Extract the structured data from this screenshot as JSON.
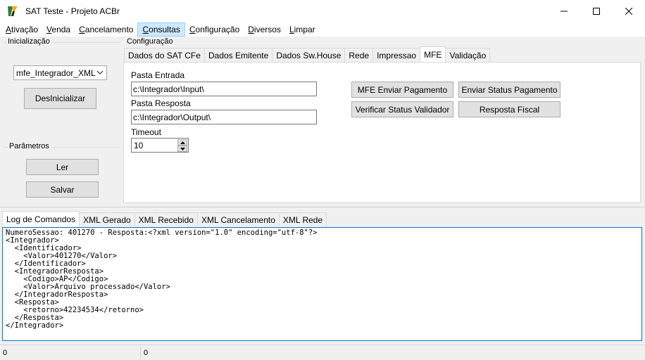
{
  "window": {
    "title": "SAT Teste - Projeto ACBr",
    "minimize": "—",
    "maximize": "☐",
    "close": "✕"
  },
  "menu": [
    {
      "underline": "A",
      "rest": "tivação"
    },
    {
      "underline": "V",
      "rest": "enda"
    },
    {
      "underline": "C",
      "rest": "ancelamento"
    },
    {
      "underline": "C",
      "rest": "onsultas"
    },
    {
      "underline": "C",
      "rest": "onfiguração"
    },
    {
      "underline": "D",
      "rest": "iversos"
    },
    {
      "underline": "L",
      "rest": "impar"
    }
  ],
  "inicializacao": {
    "title": "Inicialização",
    "combo_value": "mfe_Integrador_XML",
    "button": "DesInicializar"
  },
  "parametros": {
    "title": "Parâmetros",
    "ler": "Ler",
    "salvar": "Salvar"
  },
  "configuracao": {
    "title": "Configuração",
    "tabs": [
      "Dados do SAT CFe",
      "Dados Emitente",
      "Dados Sw.House",
      "Rede",
      "Impressao",
      "MFE",
      "Validação"
    ],
    "active_tab": "MFE",
    "pasta_entrada_label": "Pasta Entrada",
    "pasta_entrada_value": "c:\\Integrador\\Input\\",
    "pasta_resposta_label": "Pasta Resposta",
    "pasta_resposta_value": "c:\\Integrador\\Output\\",
    "timeout_label": "Timeout",
    "timeout_value": "10",
    "btn_enviar_pagamento": "MFE Enviar Pagamento",
    "btn_enviar_status": "Enviar Status Pagamento",
    "btn_verificar_status": "Verificar Status Validador",
    "btn_resposta_fiscal": "Resposta Fiscal"
  },
  "bottom_tabs": [
    "Log de Comandos",
    "XML Gerado",
    "XML Recebido",
    "XML Cancelamento",
    "XML Rede"
  ],
  "log_text": "NumeroSessao: 401270 - Resposta:<?xml version=\"1.0\" encoding=\"utf-8\"?>\n<Integrador>\n  <Identificador>\n    <Valor>401270</Valor>\n  </Identificador>\n  <IntegradorResposta>\n    <Codigo>AP</Codigo>\n    <Valor>Arquivo processado</Valor>\n  </IntegradorResposta>\n  <Resposta>\n    <retorno>42234534</retorno>\n  </Resposta>\n</Integrador>",
  "status": [
    "0",
    "0"
  ]
}
